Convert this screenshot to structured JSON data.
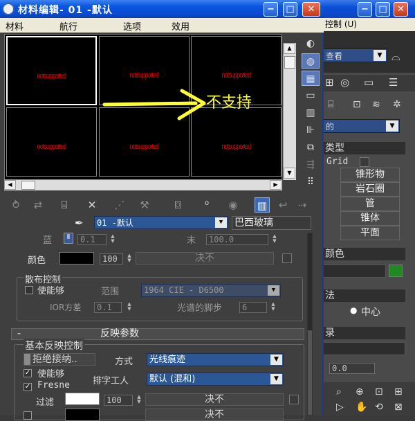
{
  "window": {
    "title": "材料编辑- 01 -默认",
    "min_label": "−",
    "max_label": "□",
    "close_label": "✕"
  },
  "menu": [
    "材料",
    "航行",
    "选项",
    "效用"
  ],
  "preview": {
    "slot_text": "notsupported",
    "annotation": "不支持"
  },
  "material": {
    "name": "01 -默认",
    "type": "巴西玻璃"
  },
  "params": {
    "blue_label": "蓝",
    "blue_value": "0.1",
    "end_label": "末",
    "end_value": "100.0",
    "color_label": "颜色",
    "color_value": "100",
    "color_map_label": "决不",
    "dispersion": {
      "title": "散布控制",
      "enable_label": "使能够",
      "range_label": "范围",
      "range_value": "1964 CIE - D6500",
      "ior_label": "IOR方差",
      "ior_value": "0.1",
      "step_label": "光谱的脚步",
      "step_value": "6"
    },
    "reflection_rollout": {
      "minus": "-",
      "title": "反映参数"
    },
    "basic_reflection": {
      "title": "基本反映控制",
      "reject_label": "拒绝接纳..",
      "mode_label": "方式",
      "mode_value": "光线痕迹",
      "enable_label": "使能够",
      "worker_label": "排字工人",
      "worker_value": "默认 (混和)",
      "fresnel_label": "Fresne",
      "filter_label": "过滤",
      "filter_value": "100",
      "filter_map_label": "决不",
      "bottom_label": "决不"
    }
  },
  "bg_window": {
    "menu_label": "控制 (U)",
    "view_dropdown": "查看",
    "object_dropdown": "的",
    "type_header": "类型",
    "grid_label": "Grid",
    "buttons": [
      "锥形物",
      "岩石圈",
      "管",
      "锥体",
      "平面"
    ],
    "color_header": "颜色",
    "method_header": "法",
    "center_label": "中心",
    "record_header": "录",
    "spinner_value": "0.0"
  },
  "colors": {
    "titlebar": "#0a55e0",
    "preview_text": "#e00000",
    "annotation": "#ffff33",
    "selection": "#2b5797",
    "green_swatch": "#1f8a1f"
  }
}
